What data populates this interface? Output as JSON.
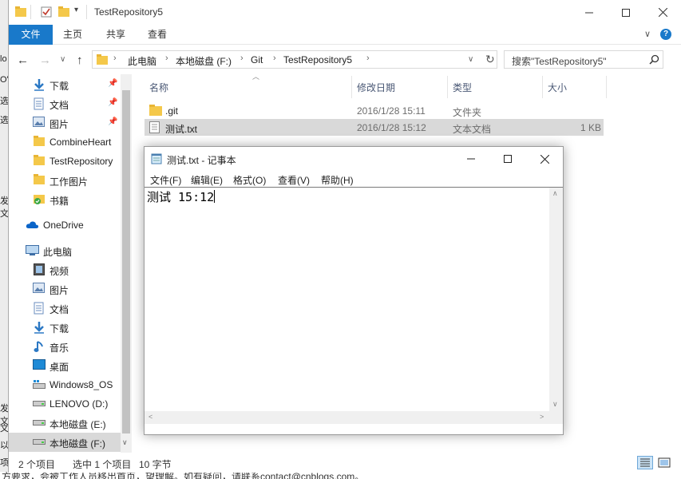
{
  "explorer": {
    "window_title": "TestRepository5",
    "ribbon_tabs": [
      "文件",
      "主页",
      "共享",
      "查看"
    ],
    "nav_buttons": {
      "back": "←",
      "forward": "→",
      "recent": "∨",
      "up": "↑"
    },
    "breadcrumb": [
      "此电脑",
      "本地磁盘 (F:)",
      "Git",
      "TestRepository5"
    ],
    "search_placeholder": "搜索\"TestRepository5\"",
    "nav_items": [
      {
        "label": "下载",
        "icon": "download-arrow-icon",
        "pinned": true
      },
      {
        "label": "文档",
        "icon": "document-icon",
        "pinned": true
      },
      {
        "label": "图片",
        "icon": "pictures-icon",
        "pinned": true
      },
      {
        "label": "CombineHeart",
        "icon": "folder-icon",
        "pinned": false
      },
      {
        "label": "TestRepository",
        "icon": "folder-icon",
        "pinned": false
      },
      {
        "label": "工作图片",
        "icon": "folder-icon",
        "pinned": false
      },
      {
        "label": "书籍",
        "icon": "folder-sync-icon",
        "pinned": false
      },
      {
        "label": "OneDrive",
        "icon": "cloud-icon",
        "pinned": false
      },
      {
        "label": "此电脑",
        "icon": "computer-icon",
        "pinned": false
      },
      {
        "label": "视频",
        "icon": "video-icon",
        "pinned": false
      },
      {
        "label": "图片",
        "icon": "pictures-icon",
        "pinned": false
      },
      {
        "label": "文档",
        "icon": "document-icon",
        "pinned": false
      },
      {
        "label": "下载",
        "icon": "download-arrow-icon",
        "pinned": false
      },
      {
        "label": "音乐",
        "icon": "music-note-icon",
        "pinned": false
      },
      {
        "label": "桌面",
        "icon": "desktop-icon",
        "pinned": false
      },
      {
        "label": "Windows8_OS",
        "icon": "drive-windows-icon",
        "pinned": false
      },
      {
        "label": "LENOVO (D:)",
        "icon": "drive-icon",
        "pinned": false
      },
      {
        "label": "本地磁盘 (E:)",
        "icon": "drive-icon",
        "pinned": false
      },
      {
        "label": "本地磁盘 (F:)",
        "icon": "drive-icon",
        "pinned": false
      }
    ],
    "columns": {
      "name": "名称",
      "date": "修改日期",
      "type": "类型",
      "size": "大小"
    },
    "files": [
      {
        "name": ".git",
        "date": "2016/1/28 15:11",
        "type": "文件夹",
        "size": "",
        "icon": "folder-icon",
        "selected": false
      },
      {
        "name": "测试.txt",
        "date": "2016/1/28 15:12",
        "type": "文本文档",
        "size": "1 KB",
        "icon": "text-file-icon",
        "selected": true
      }
    ],
    "status": {
      "count": "2 个项目",
      "selected": "选中 1 个项目",
      "size": "10 字节"
    }
  },
  "notepad": {
    "title": "测试.txt - 记事本",
    "menus": [
      "文件(F)",
      "编辑(E)",
      "格式(O)",
      "查看(V)",
      "帮助(H)"
    ],
    "content": "测试 15:12"
  },
  "background": {
    "bottom_text": "方要求，会被工作人员移出首页，望理解。如有疑问，请联系contact@cnblogs.com。",
    "left_fragments": [
      "lo",
      "O'",
      "选",
      "选",
      "发文",
      "发文",
      "文 ",
      "以",
      "项"
    ]
  },
  "colors": {
    "accent": "#1979ca",
    "selection": "#d9d9d9",
    "folder": "#f4c84a"
  }
}
